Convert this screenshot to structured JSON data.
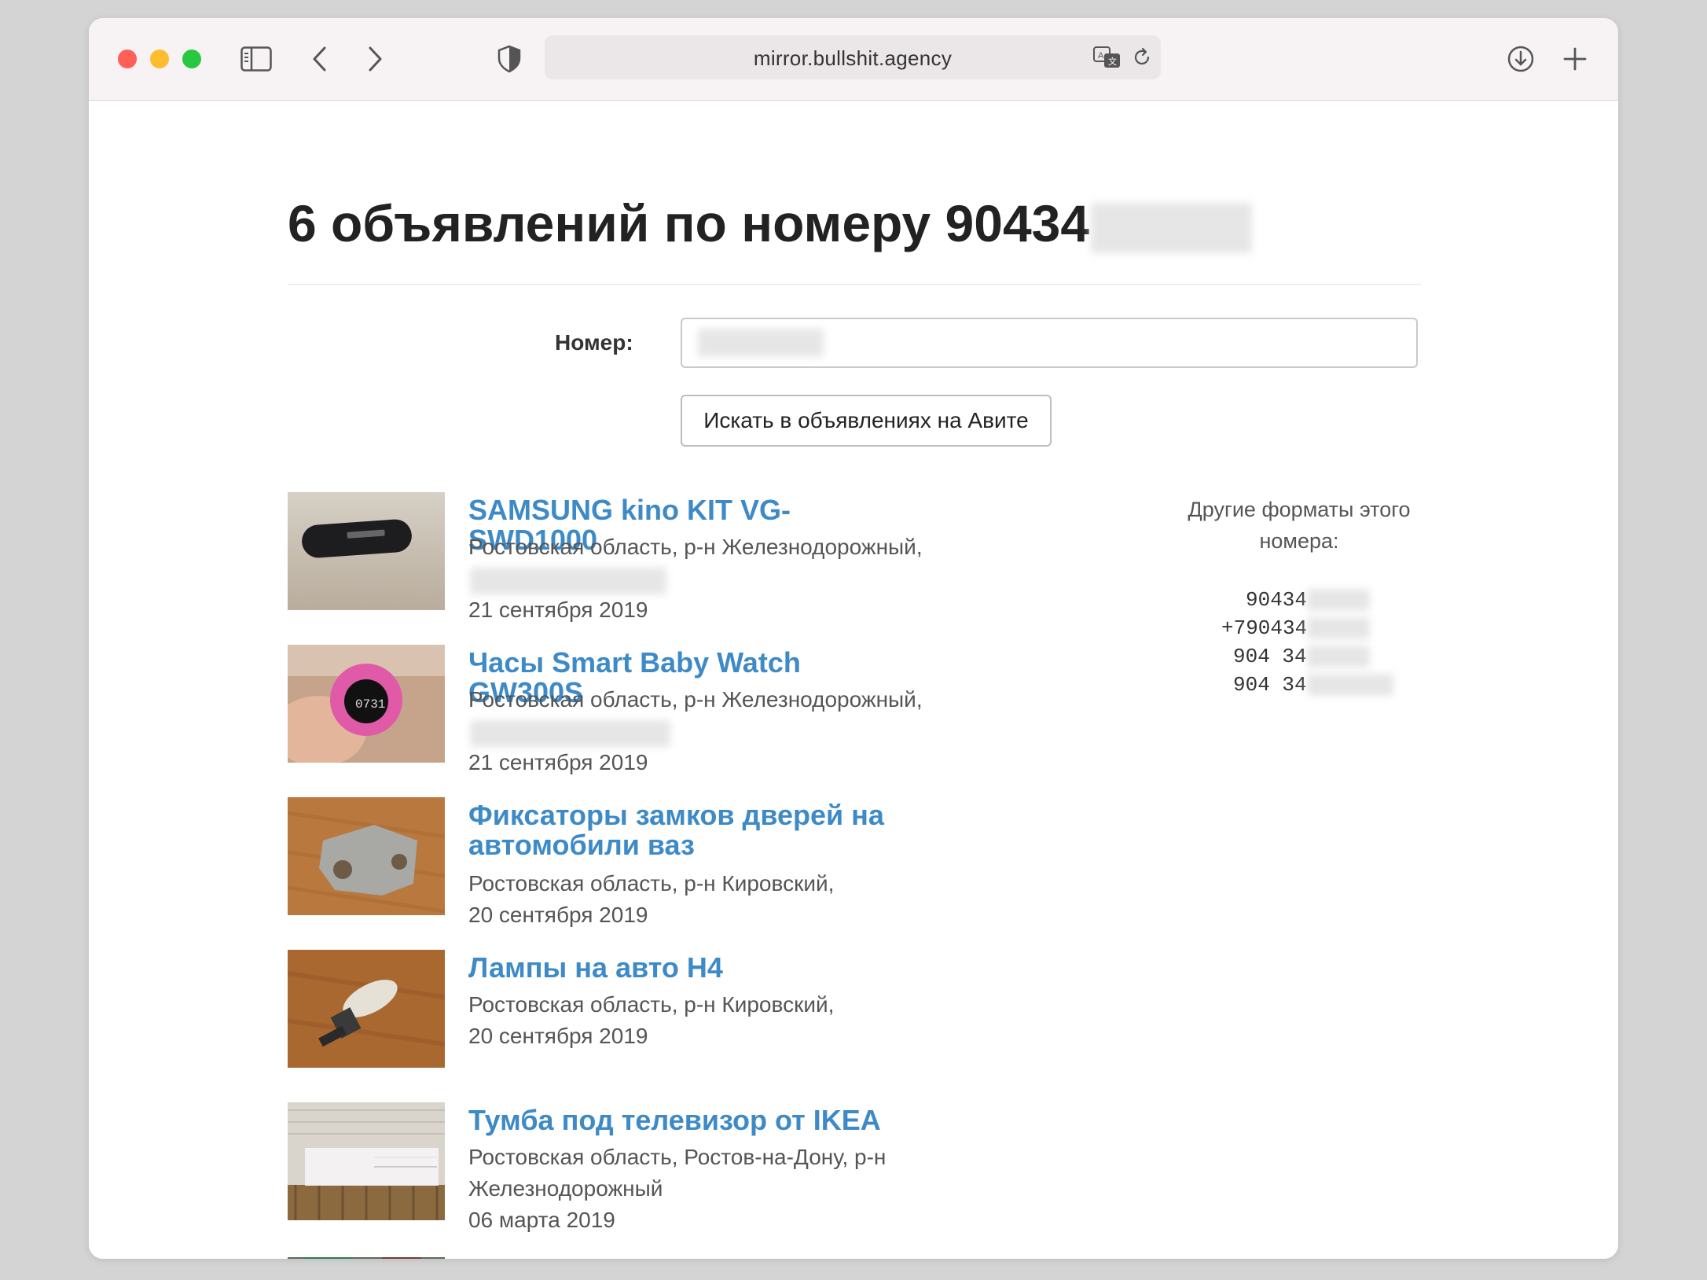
{
  "browser": {
    "url": "mirror.bullshit.agency"
  },
  "page": {
    "heading": "6 объявлений по номеру 90434",
    "form_label": "Номер:",
    "search_button": "Искать в объявлениях на Авите"
  },
  "listings": [
    {
      "title": "SAMSUNG kino KIT VG-SWD1000",
      "location": "Ростовская область, р-н Железнодорожный,",
      "date": "21 сентября 2019"
    },
    {
      "title": "Часы Smart Baby Watch GW300S",
      "location": "Ростовская область, р-н Железнодорожный,",
      "date": "21 сентября 2019"
    },
    {
      "title": "Фиксаторы замков дверей на автомобили ваз",
      "location": "Ростовская область, р-н Кировский,",
      "date": "20 сентября 2019"
    },
    {
      "title": "Лампы на авто H4",
      "location": "Ростовская область, р-н Кировский,",
      "date": "20 сентября 2019"
    },
    {
      "title": "Тумба под телевизор от IKEA",
      "location": "Ростовская область, Ростов-на-Дону, р-н Железнодорожный",
      "date": "06 марта 2019"
    }
  ],
  "sidebar": {
    "title": "Другие форматы этого номера:",
    "formats": [
      "90434",
      "+790434",
      "904 34",
      "904 34"
    ]
  }
}
